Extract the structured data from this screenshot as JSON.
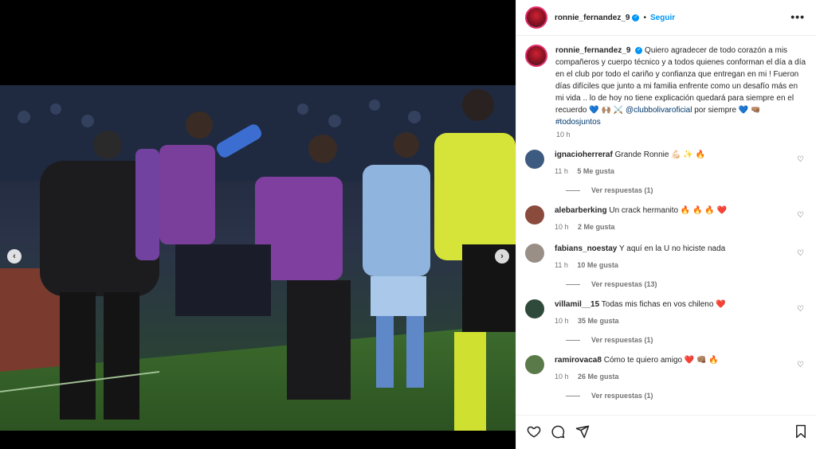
{
  "post": {
    "username": "ronnie_fernandez_9",
    "follow_label": "Seguir",
    "more_label": "•••",
    "caption_text": "Quiero agradecer de todo corazón a mis compañeros y cuerpo técnico y a todos quienes conforman el día a día en el club por todo el cariño y confianza que entregan en mi ! Fueron días difíciles que junto a mi familia enfrente como un desafío más en mi vida .. lo de hoy no tiene explicación quedará para siempre en el recuerdo 💙 🙌🏽 ⚔️",
    "caption_mention": "@clubbolivaroficial",
    "caption_tail": "por siempre 💙 🤜🏽",
    "caption_hashtag": "#todosjuntos",
    "caption_time": "10 h"
  },
  "comments": [
    {
      "username": "ignacioherreraf",
      "text": "Grande Ronnie 💪🏻 ✨ 🔥",
      "time": "11 h",
      "likes": "5 Me gusta",
      "replies": "Ver respuestas (1)",
      "avatar_color": "#3d5a80"
    },
    {
      "username": "alebarberking",
      "text": "Un crack hermanito 🔥 🔥 🔥 ❤️",
      "time": "10 h",
      "likes": "2 Me gusta",
      "replies": "",
      "avatar_color": "#8a4b3c"
    },
    {
      "username": "fabians_noestay",
      "text": "Y aquí en la U no hiciste nada",
      "time": "11 h",
      "likes": "10 Me gusta",
      "replies": "Ver respuestas (13)",
      "avatar_color": "#9a8f87"
    },
    {
      "username": "villamil__15",
      "text": "Todas mis fichas en vos chileno ❤️",
      "time": "10 h",
      "likes": "35 Me gusta",
      "replies": "Ver respuestas (1)",
      "avatar_color": "#2f4a3a"
    },
    {
      "username": "ramirovaca8",
      "text": "Cómo te quiero amigo ❤️ 👊🏽 🔥",
      "time": "10 h",
      "likes": "26 Me gusta",
      "replies": "Ver respuestas (1)",
      "avatar_color": "#5b7a4a"
    }
  ],
  "icons": {
    "like": "heart-icon",
    "comment": "comment-icon",
    "share": "send-icon",
    "save": "bookmark-icon",
    "prev": "chevron-left-icon",
    "next": "chevron-right-icon"
  },
  "nav": {
    "prev": "‹",
    "next": "›"
  }
}
